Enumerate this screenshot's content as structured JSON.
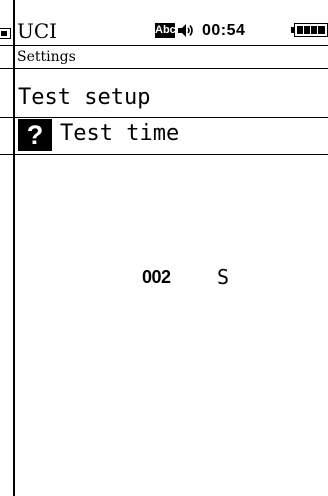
{
  "status_bar": {
    "title": "UCI",
    "input_mode": "Abc",
    "time": "00:54"
  },
  "breadcrumb": "Settings",
  "menu": {
    "items": [
      {
        "label": "Test setup"
      },
      {
        "label": "Test time"
      }
    ]
  },
  "value": {
    "number": "002",
    "unit": "S"
  },
  "icons": {
    "input_mode": "keyboard-mode-icon",
    "sound": "speaker-icon",
    "battery": "battery-icon",
    "help": "question-icon"
  },
  "colors": {
    "background": "#ffffff",
    "foreground": "#000000"
  }
}
